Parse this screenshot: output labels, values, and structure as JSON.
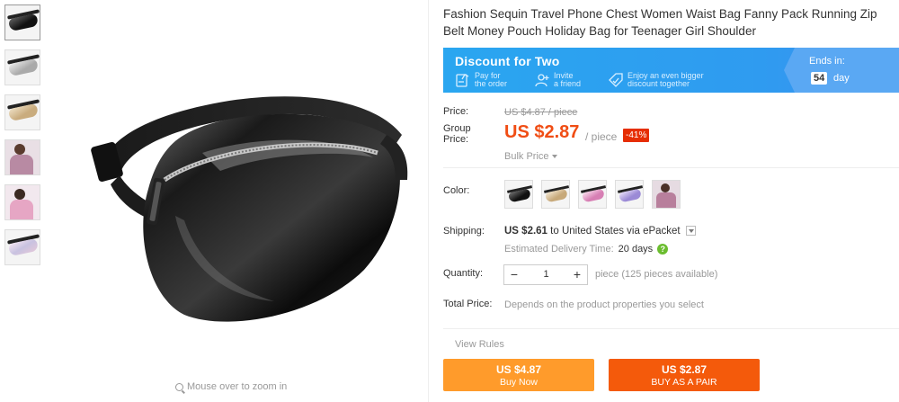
{
  "product": {
    "title": "Fashion Sequin Travel Phone Chest Women Waist Bag Fanny Pack Running Zip Belt Money Pouch Holiday Bag for Teenager Girl Shoulder"
  },
  "banner": {
    "title": "Discount for Two",
    "step1": "Pay for\nthe order",
    "step1_a": "Pay for",
    "step1_b": "the order",
    "step2_a": "Invite",
    "step2_b": "a friend",
    "step3_a": "Enjoy an even bigger",
    "step3_b": "discount together",
    "ends_label": "Ends in:",
    "ends_value": "54",
    "ends_unit": "day"
  },
  "price": {
    "label": "Price:",
    "original": "US $4.87 / piece",
    "group_label_a": "Group",
    "group_label_b": "Price:",
    "group": "US $2.87",
    "unit": "/ piece",
    "discount": "-41%",
    "bulk": "Bulk Price"
  },
  "color": {
    "label": "Color:",
    "swatches": [
      "black",
      "gold",
      "pink",
      "purple",
      "photo"
    ]
  },
  "shipping": {
    "label": "Shipping:",
    "price": "US $2.61",
    "to": "to United States via ePacket",
    "est_label": "Estimated Delivery Time:",
    "est_days": "20 days",
    "help": "?"
  },
  "quantity": {
    "label": "Quantity:",
    "minus": "−",
    "value": "1",
    "plus": "+",
    "available": "piece (125 pieces available)"
  },
  "total": {
    "label": "Total Price:",
    "value": "Depends on the product properties you select"
  },
  "actions": {
    "rules": "View Rules",
    "buy_now_price": "US $4.87",
    "buy_now_label": "Buy Now",
    "buy_pair_price": "US $2.87",
    "buy_pair_label": "BUY AS A PAIR"
  },
  "gallery": {
    "zoom_hint": "Mouse over to zoom in"
  },
  "colors": {
    "accent_orange": "#f04d14",
    "banner_blue": "#2aa6f0",
    "buy_now": "#ff9b2b",
    "buy_pair": "#f45a0b"
  }
}
